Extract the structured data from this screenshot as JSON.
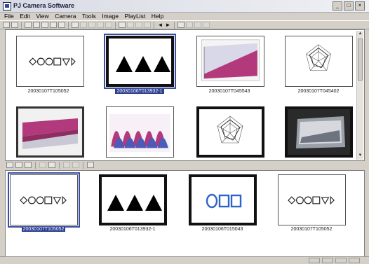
{
  "window": {
    "title": "PJ Camera Software",
    "minimize": "_",
    "restore": "□",
    "close": "×"
  },
  "menu": [
    "File",
    "Edit",
    "View",
    "Camera",
    "Tools",
    "Image",
    "PlayList",
    "Help"
  ],
  "toolbar": {
    "arrow_left": "◄",
    "arrow_right": "►"
  },
  "top_pane": {
    "thumbnails": [
      {
        "caption": "20030107T105052",
        "art": "shapes-row"
      },
      {
        "caption": "20030106T013932-1",
        "art": "triangles",
        "selected": true
      },
      {
        "caption": "20030107T045543",
        "art": "surface-chart"
      },
      {
        "caption": "20030107T045402",
        "art": "radar-chart"
      },
      {
        "caption": "",
        "art": "ribbon-chart"
      },
      {
        "caption": "",
        "art": "cone-chart"
      },
      {
        "caption": "",
        "art": "radar-chart"
      },
      {
        "caption": "",
        "art": "photo-screen"
      }
    ],
    "scroll_up": "▲",
    "scroll_down": "▼"
  },
  "bottom_pane": {
    "thumbnails": [
      {
        "caption": "20030107T105052",
        "art": "shapes-row",
        "selected": true
      },
      {
        "caption": "20030106T013932-1",
        "art": "triangles"
      },
      {
        "caption": "20030106T015043",
        "art": "blue-shapes"
      },
      {
        "caption": "20030107T105052",
        "art": "shapes-row"
      }
    ]
  },
  "colors": {
    "selection": "#2a3d8f",
    "accent_blue": "#2f63c9",
    "chart_magenta": "#b23a7c"
  }
}
